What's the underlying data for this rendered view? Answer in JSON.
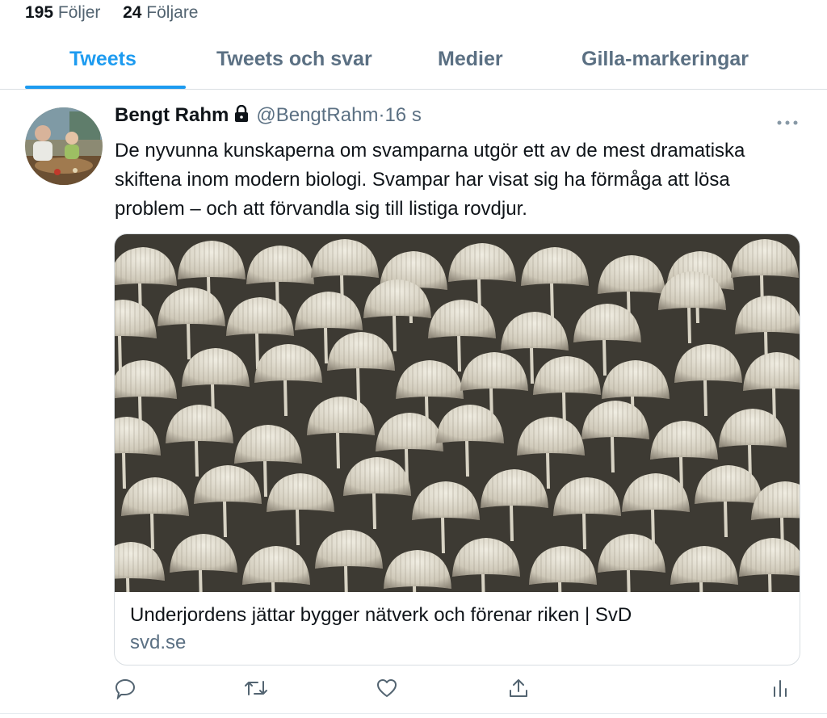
{
  "profile_stats": {
    "following_count": "195",
    "following_label": "Följer",
    "followers_count": "24",
    "followers_label": "Följare"
  },
  "tabs": [
    {
      "label": "Tweets",
      "active": true
    },
    {
      "label": "Tweets och svar",
      "active": false
    },
    {
      "label": "Medier",
      "active": false
    },
    {
      "label": "Gilla-markeringar",
      "active": false
    }
  ],
  "tweet": {
    "author_name": "Bengt Rahm",
    "handle": "@BengtRahm",
    "separator": "·",
    "time": "16 s",
    "text": "De nyvunna kunskaperna om svamparna utgör ett av de mest dramatiska skiftena inom modern biologi. Svampar har visat sig ha förmåga att lösa problem – och att förvandla sig till listiga rovdjur.",
    "more_icon": "…",
    "card": {
      "title": "Underjordens jättar bygger nätverk och förenar riken | SvD",
      "domain": "svd.se"
    },
    "actions": [
      "reply-icon",
      "retweet-icon",
      "like-icon",
      "share-icon",
      "analytics-icon"
    ]
  },
  "colors": {
    "accent": "#1d9bf0",
    "secondary_text": "#5b7083",
    "border": "#d9dee2"
  }
}
